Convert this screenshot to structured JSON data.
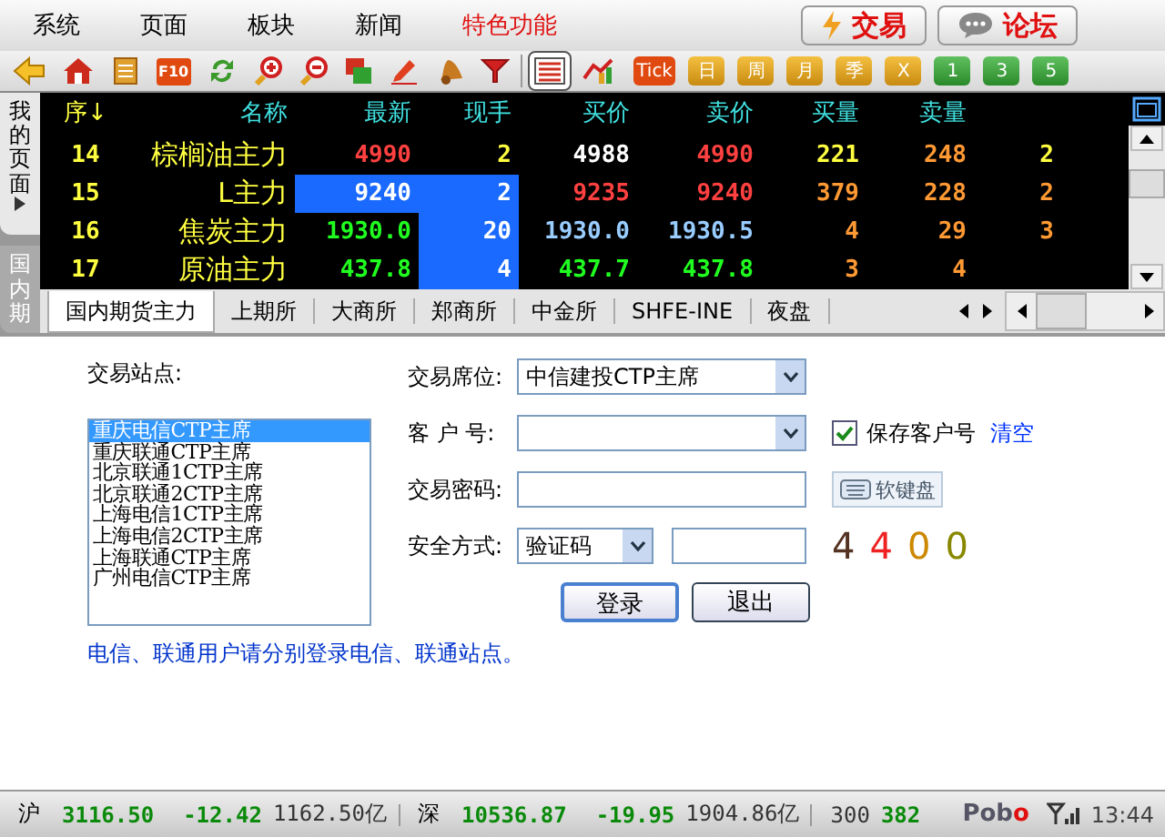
{
  "menu": [
    {
      "label": "系统",
      "accent": false
    },
    {
      "label": "页面",
      "accent": false
    },
    {
      "label": "板块",
      "accent": false
    },
    {
      "label": "新闻",
      "accent": false
    },
    {
      "label": "特色功能",
      "accent": true
    }
  ],
  "top_buttons": [
    {
      "kind": "trade",
      "label": "交易"
    },
    {
      "kind": "forum",
      "label": "论坛"
    }
  ],
  "toolbar": {
    "icons": [
      {
        "kind": "back"
      },
      {
        "kind": "home"
      },
      {
        "kind": "notes"
      },
      {
        "kind": "f10",
        "label": "F10"
      },
      {
        "kind": "refresh"
      },
      {
        "kind": "zoomin"
      },
      {
        "kind": "zoomout"
      },
      {
        "kind": "windows"
      },
      {
        "kind": "pencil"
      },
      {
        "kind": "bell"
      },
      {
        "kind": "funnel"
      },
      {
        "kind": "table",
        "selected": true
      },
      {
        "kind": "chart",
        "selected": false
      }
    ],
    "periods": [
      {
        "label": "Tick",
        "kind": "red"
      },
      {
        "label": "日",
        "kind": "gold"
      },
      {
        "label": "周",
        "kind": "gold"
      },
      {
        "label": "月",
        "kind": "gold"
      },
      {
        "label": "季",
        "kind": "gold"
      },
      {
        "label": "X",
        "kind": "gold"
      },
      {
        "label": "1",
        "kind": "green"
      },
      {
        "label": "3",
        "kind": "green"
      },
      {
        "label": "5",
        "kind": "green"
      }
    ]
  },
  "side_tabs": [
    {
      "label": "我的页面",
      "selected": true
    },
    {
      "label": "国内期",
      "selected": false
    }
  ],
  "quote_table": {
    "columns": [
      "序↓",
      "名称",
      "最新",
      "现手",
      "买价",
      "卖价",
      "买量",
      "卖量"
    ],
    "rows": [
      [
        {
          "text": "14",
          "color": "#ffff40",
          "highlight": false
        },
        {
          "text": "棕榈油主力",
          "color": "#ffff40",
          "highlight": false
        },
        {
          "text": "4990",
          "color": "#ff4040",
          "highlight": false
        },
        {
          "text": "2",
          "color": "#ffff40",
          "highlight": false
        },
        {
          "text": "4988",
          "color": "#ffffff",
          "highlight": false
        },
        {
          "text": "4990",
          "color": "#ff4040",
          "highlight": false
        },
        {
          "text": "221",
          "color": "#ffff40",
          "highlight": false
        },
        {
          "text": "248",
          "color": "#ff9933",
          "highlight": false
        },
        {
          "text": "2",
          "color": "#ffff40",
          "highlight": false
        }
      ],
      [
        {
          "text": "15",
          "color": "#ffff40",
          "highlight": false
        },
        {
          "text": "L主力",
          "color": "#ffff40",
          "highlight": false
        },
        {
          "text": "9240",
          "color": "#ffffff",
          "highlight": true
        },
        {
          "text": "2",
          "color": "#ffffff",
          "highlight": true
        },
        {
          "text": "9235",
          "color": "#ff4040",
          "highlight": false
        },
        {
          "text": "9240",
          "color": "#ff4040",
          "highlight": false
        },
        {
          "text": "379",
          "color": "#ff9933",
          "highlight": false
        },
        {
          "text": "228",
          "color": "#ff9933",
          "highlight": false
        },
        {
          "text": "2",
          "color": "#ff9933",
          "highlight": false
        }
      ],
      [
        {
          "text": "16",
          "color": "#ffff40",
          "highlight": false
        },
        {
          "text": "焦炭主力",
          "color": "#ffff40",
          "highlight": false
        },
        {
          "text": "1930.0",
          "color": "#20ff20",
          "highlight": false
        },
        {
          "text": "20",
          "color": "#ffffff",
          "highlight": true
        },
        {
          "text": "1930.0",
          "color": "#99ccff",
          "highlight": false
        },
        {
          "text": "1930.5",
          "color": "#99ccff",
          "highlight": false
        },
        {
          "text": "4",
          "color": "#ff9933",
          "highlight": false
        },
        {
          "text": "29",
          "color": "#ff9933",
          "highlight": false
        },
        {
          "text": "3",
          "color": "#ff9933",
          "highlight": false
        }
      ],
      [
        {
          "text": "17",
          "color": "#ffff40",
          "highlight": false
        },
        {
          "text": "原油主力",
          "color": "#ffff40",
          "highlight": false
        },
        {
          "text": "437.8",
          "color": "#20ff20",
          "highlight": false
        },
        {
          "text": "4",
          "color": "#ffffff",
          "highlight": true
        },
        {
          "text": "437.7",
          "color": "#20ff20",
          "highlight": false
        },
        {
          "text": "437.8",
          "color": "#20ff20",
          "highlight": false
        },
        {
          "text": "3",
          "color": "#ff9933",
          "highlight": false
        },
        {
          "text": "4",
          "color": "#ff9933",
          "highlight": false
        }
      ]
    ]
  },
  "exchange_tabs": [
    {
      "label": "国内期货主力",
      "selected": true
    },
    {
      "label": "上期所",
      "selected": false
    },
    {
      "label": "大商所",
      "selected": false
    },
    {
      "label": "郑商所",
      "selected": false
    },
    {
      "label": "中金所",
      "selected": false
    },
    {
      "label": "SHFE-INE",
      "selected": false
    },
    {
      "label": "夜盘",
      "selected": false
    }
  ],
  "login": {
    "station_label": "交易站点:",
    "stations": [
      {
        "label": "重庆电信CTP主席",
        "selected": true
      },
      {
        "label": "重庆联通CTP主席",
        "selected": false
      },
      {
        "label": "北京联通1CTP主席",
        "selected": false
      },
      {
        "label": "北京联通2CTP主席",
        "selected": false
      },
      {
        "label": "上海电信1CTP主席",
        "selected": false
      },
      {
        "label": "上海电信2CTP主席",
        "selected": false
      },
      {
        "label": "上海联通CTP主席",
        "selected": false
      },
      {
        "label": "广州电信CTP主席",
        "selected": false
      }
    ],
    "seat_label": "交易席位:",
    "seat_value": "中信建投CTP主席",
    "account_label": "客 户 号:",
    "save_account": {
      "label": "保存客户号",
      "checked": true
    },
    "clear_link": "清空",
    "password_label": "交易密码:",
    "soft_keyboard": "软键盘",
    "security_label": "安全方式:",
    "security_value": "验证码",
    "captcha": [
      {
        "text": "4",
        "color": "#553322"
      },
      {
        "text": "4",
        "color": "#ee2222"
      },
      {
        "text": "0",
        "color": "#cc8800"
      },
      {
        "text": "0",
        "color": "#888800"
      }
    ],
    "buttons": [
      "登录",
      "退出"
    ],
    "note": "电信、联通用户请分别登录电信、联通站点。"
  },
  "status_bar": {
    "markets": [
      {
        "name": "沪",
        "index": "3116.50",
        "change": "-12.42",
        "amount": "1162.50亿"
      },
      {
        "name": "深",
        "index": "10536.87",
        "change": "-19.95",
        "amount": "1904.86亿"
      }
    ],
    "extra_name": "300",
    "extra_value": "382",
    "logo_main": "Pob",
    "logo_accent": "o",
    "time": "13:44"
  }
}
